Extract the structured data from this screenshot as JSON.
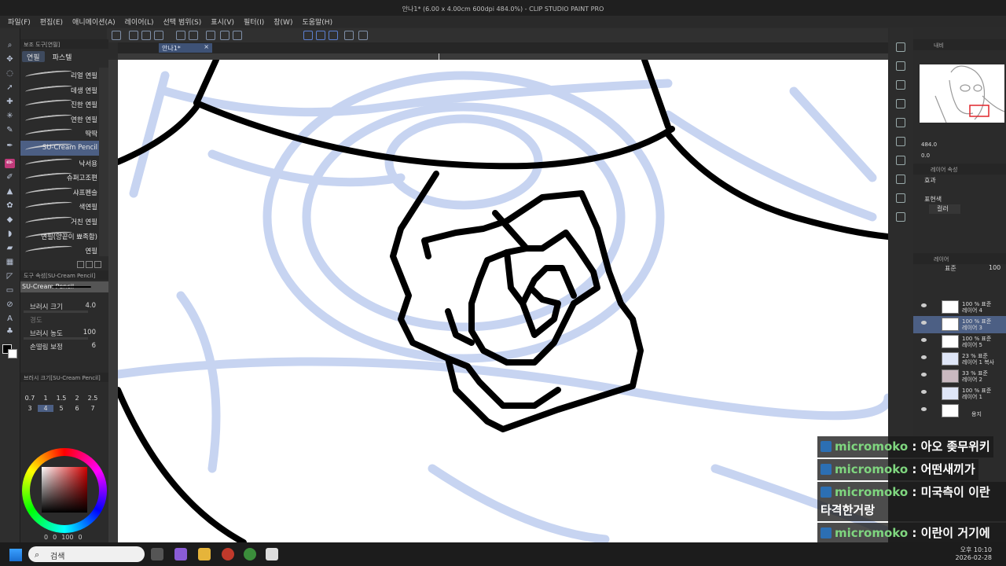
{
  "window": {
    "title": "안나1* (6.00 x 4.00cm 600dpi 484.0%) - CLIP STUDIO PAINT PRO"
  },
  "menu": [
    "파일(F)",
    "편집(E)",
    "애니메이션(A)",
    "레이어(L)",
    "선택 범위(S)",
    "표시(V)",
    "필터(I)",
    "창(W)",
    "도움말(H)"
  ],
  "document_tab": {
    "label": "안나1*",
    "close": "×"
  },
  "subtool_panel": {
    "title": "보조 도구[연필]",
    "tabs": [
      "연필",
      "파스텔"
    ],
    "brushes": [
      "리얼 연필",
      "데생 연필",
      "진한 연필",
      "연한 연필",
      "딱딱",
      "SU-Cream Pencil",
      "낙서용",
      "슈퍼고조편",
      "샤프펜슬",
      "색연필",
      "거친 연필",
      "연필(양끝이 뾰족함)",
      "연필"
    ],
    "selected_brush": "SU-Cream Pencil"
  },
  "tool_props": {
    "title": "도구 속성[SU-Cream Pencil]",
    "preview_name": "SU-Cream Pencil",
    "brush_size_label": "브러시 크기",
    "brush_size_value": "4.0",
    "hardness_label": "경도",
    "density_label": "브러시 농도",
    "density_value": "100",
    "stabilization_label": "손떨림 보정",
    "stabilization_value": "6"
  },
  "brush_size_palette": {
    "title": "브러시 크기[SU-Cream Pencil]",
    "sizes": [
      "0.7",
      "1",
      "1.5",
      "2",
      "2.5",
      "3",
      "4",
      "5",
      "6",
      "7"
    ],
    "selected": "4"
  },
  "color_bar": {
    "h": "0",
    "s": "0",
    "v": "100",
    "extra": "0"
  },
  "navigator": {
    "zoom": "484.0",
    "angle": "0.0",
    "header": "내비"
  },
  "layer_props": {
    "title": "레이어 속성",
    "effect_label": "효과",
    "expression_label": "표현색",
    "expression_value": "컬러"
  },
  "layer_panel": {
    "title": "레이어",
    "blend_mode": "표준",
    "opacity": "100",
    "layers": [
      {
        "opacity": "100 % 표준",
        "name": "레이어 4",
        "selected": false
      },
      {
        "opacity": "100 % 표준",
        "name": "레이어 3",
        "selected": true
      },
      {
        "opacity": "100 % 표준",
        "name": "레이어 5",
        "selected": false
      },
      {
        "opacity": "23 % 표준",
        "name": "레이어 1 복사",
        "selected": false
      },
      {
        "opacity": "33 % 표준",
        "name": "레이어 2",
        "selected": false
      },
      {
        "opacity": "100 % 표준",
        "name": "레이어 1",
        "selected": false
      },
      {
        "opacity": "",
        "name": "용지",
        "selected": false
      }
    ]
  },
  "chat": [
    {
      "user": "micromoko",
      "sep": " : ",
      "message": "아오 좆무위키"
    },
    {
      "user": "micromoko",
      "sep": " : ",
      "message": "어떤새끼가"
    },
    {
      "user": "micromoko",
      "sep": " : ",
      "message": "미국측이 이란 타격한거랑"
    },
    {
      "user": "micromoko",
      "sep": " : ",
      "message": "이란이 거기에 반격한걸"
    }
  ],
  "taskbar": {
    "search_placeholder": "검색",
    "time": "오후 10:10",
    "date": "2026-02-28"
  }
}
